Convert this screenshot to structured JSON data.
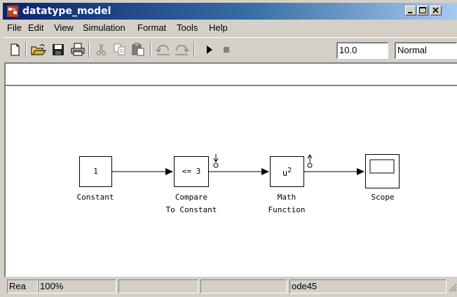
{
  "window": {
    "title": "datatype_model",
    "title_bar_color": "#0a246a"
  },
  "menu": [
    "File",
    "Edit",
    "View",
    "Simulation",
    "Format",
    "Tools",
    "Help"
  ],
  "toolbar": {
    "stop_time": "10.0",
    "sim_mode": "Normal",
    "icons": [
      "new-icon",
      "open-icon",
      "save-icon",
      "print-icon",
      "cut-icon",
      "copy-icon",
      "paste-icon",
      "undo-icon",
      "redo-icon",
      "run-icon",
      "stop-icon"
    ]
  },
  "blocks": {
    "constant": {
      "content": "1",
      "label": "Constant"
    },
    "compare": {
      "content": "<= 3",
      "label_line1": "Compare",
      "label_line2": "To Constant"
    },
    "math": {
      "content_base": "u",
      "content_sup": "2",
      "label_line1": "Math",
      "label_line2": "Function"
    },
    "scope": {
      "label": "Scope"
    }
  },
  "status": {
    "ready": "Rea",
    "zoom": "100%",
    "cell3": "",
    "cell4": "",
    "solver": "ode45"
  }
}
